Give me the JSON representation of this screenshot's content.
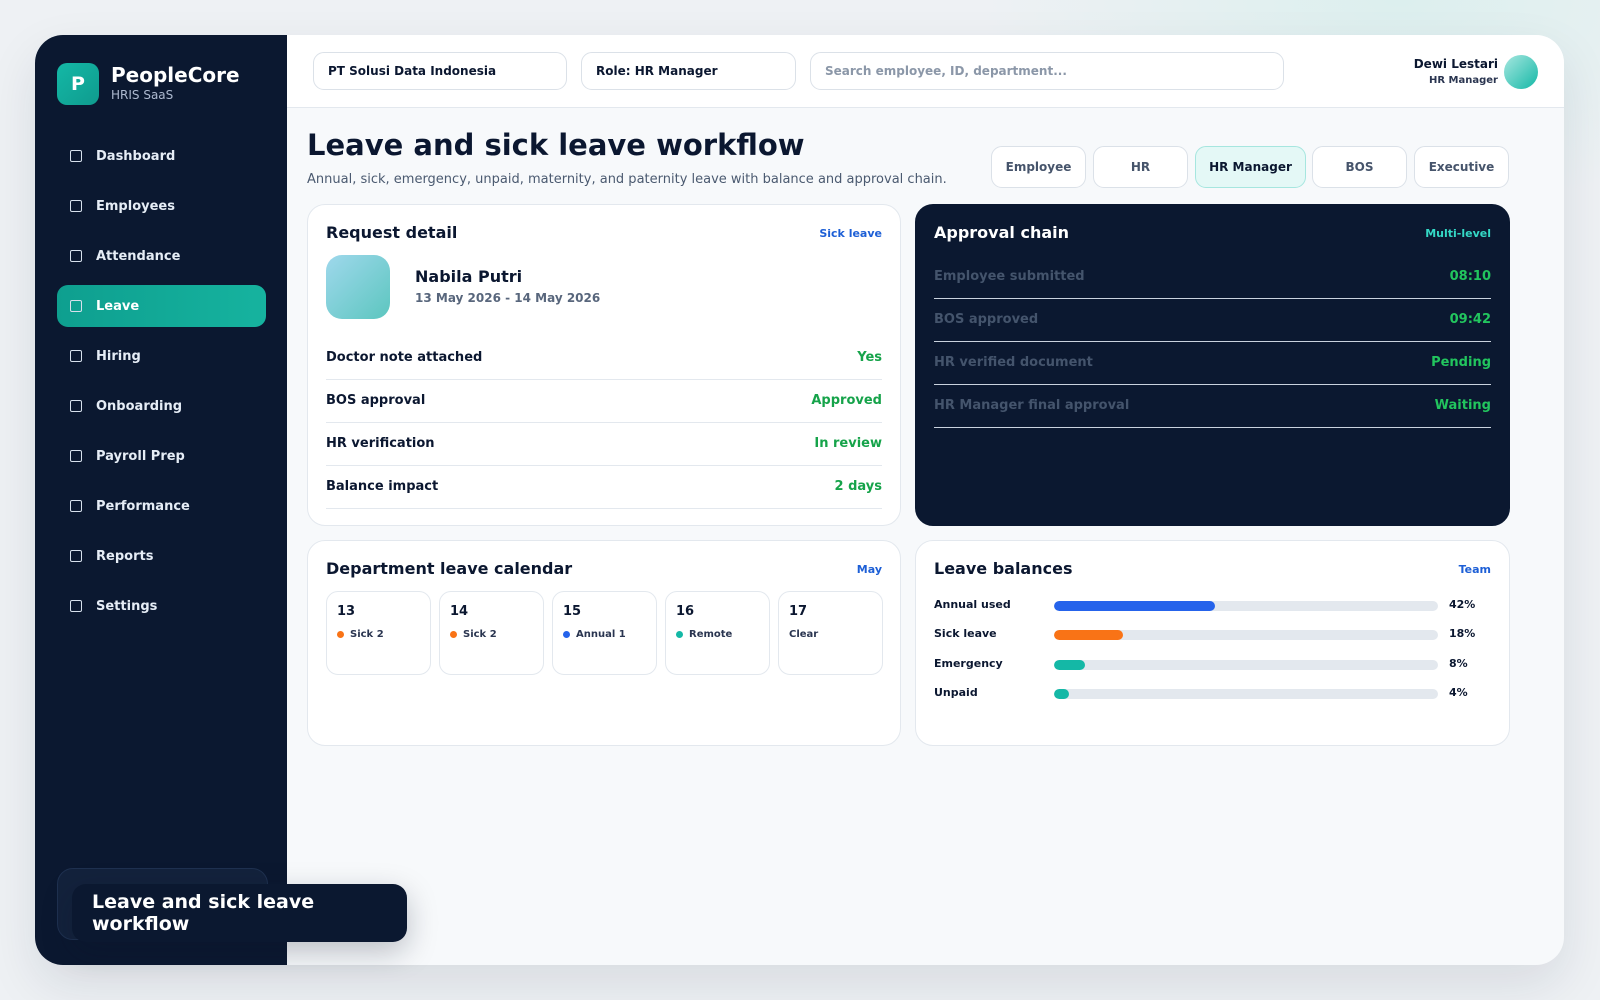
{
  "brand": {
    "logo_letter": "P",
    "name": "PeopleCore",
    "tagline": "HRIS SaaS"
  },
  "sidebar": {
    "items": [
      {
        "label": "Dashboard",
        "active": false
      },
      {
        "label": "Employees",
        "active": false
      },
      {
        "label": "Attendance",
        "active": false
      },
      {
        "label": "Leave",
        "active": true
      },
      {
        "label": "Hiring",
        "active": false
      },
      {
        "label": "Onboarding",
        "active": false
      },
      {
        "label": "Payroll Prep",
        "active": false
      },
      {
        "label": "Performance",
        "active": false
      },
      {
        "label": "Reports",
        "active": false
      },
      {
        "label": "Settings",
        "active": false
      }
    ]
  },
  "topbar": {
    "company": "PT Solusi Data Indonesia",
    "role": "Role: HR Manager",
    "search_placeholder": "Search employee, ID, department...",
    "user_name": "Dewi Lestari",
    "user_role": "HR Manager"
  },
  "header": {
    "title": "Leave and sick leave workflow",
    "subtitle": "Annual, sick, emergency, unpaid, maternity, and paternity leave with balance and approval chain."
  },
  "role_tabs": [
    {
      "label": "Employee",
      "active": false
    },
    {
      "label": "HR",
      "active": false
    },
    {
      "label": "HR Manager",
      "active": true
    },
    {
      "label": "BOS",
      "active": false
    },
    {
      "label": "Executive",
      "active": false
    }
  ],
  "request": {
    "title": "Request detail",
    "tag": "Sick leave",
    "employee": "Nabila Putri",
    "dates": "13 May 2026 - 14 May 2026",
    "rows": [
      {
        "label": "Doctor note attached",
        "value": "Yes"
      },
      {
        "label": "BOS approval",
        "value": "Approved"
      },
      {
        "label": "HR verification",
        "value": "In review"
      },
      {
        "label": "Balance impact",
        "value": "2 days"
      }
    ]
  },
  "approval": {
    "title": "Approval chain",
    "tag": "Multi-level",
    "steps": [
      {
        "label": "Employee submitted",
        "value": "08:10"
      },
      {
        "label": "BOS approved",
        "value": "09:42"
      },
      {
        "label": "HR verified document",
        "value": "Pending"
      },
      {
        "label": "HR Manager final approval",
        "value": "Waiting"
      }
    ]
  },
  "calendar": {
    "title": "Department leave calendar",
    "tag": "May",
    "days": [
      {
        "num": "13",
        "event": "Sick 2",
        "dot": "#f97316"
      },
      {
        "num": "14",
        "event": "Sick 2",
        "dot": "#f97316"
      },
      {
        "num": "15",
        "event": "Annual 1",
        "dot": "#2563eb"
      },
      {
        "num": "16",
        "event": "Remote",
        "dot": "#14b8a6"
      },
      {
        "num": "17",
        "event": "Clear",
        "dot": ""
      }
    ]
  },
  "balances": {
    "title": "Leave balances",
    "tag": "Team",
    "rows": [
      {
        "label": "Annual used",
        "pct_label": "42%",
        "fraction": 0.42,
        "color": "#2563eb"
      },
      {
        "label": "Sick leave",
        "pct_label": "18%",
        "fraction": 0.18,
        "color": "#f97316"
      },
      {
        "label": "Emergency",
        "pct_label": "8%",
        "fraction": 0.08,
        "color": "#14b8a6"
      },
      {
        "label": "Unpaid",
        "pct_label": "4%",
        "fraction": 0.04,
        "color": "#14b8a6"
      }
    ]
  },
  "toast": {
    "text": "Leave and sick leave workflow"
  }
}
